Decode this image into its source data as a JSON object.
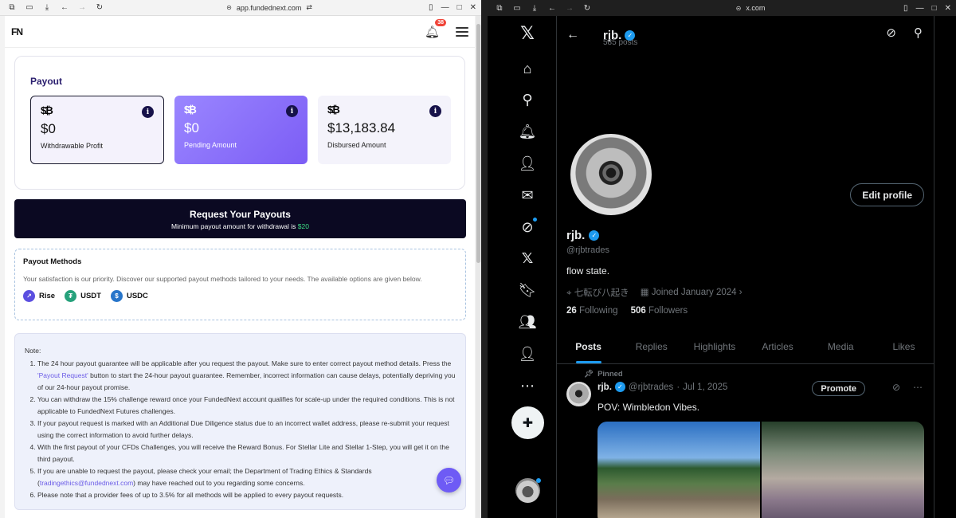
{
  "left_browser": {
    "url": "app.fundednext.com"
  },
  "fundednext": {
    "logo": "FN",
    "notification_count": "38",
    "payout": {
      "title": "Payout",
      "cards": [
        {
          "amount": "$0",
          "label": "Withdrawable Profit"
        },
        {
          "amount": "$0",
          "label": "Pending Amount"
        },
        {
          "amount": "$13,183.84",
          "label": "Disbursed Amount"
        }
      ]
    },
    "request": {
      "title": "Request Your Payouts",
      "subtitle_prefix": "Minimum payout amount for withdrawal is ",
      "min_amount": "$20"
    },
    "methods": {
      "title": "Payout Methods",
      "description": "Your satisfaction is our priority. Discover our supported payout methods tailored to your needs. The available options are given below.",
      "items": [
        {
          "name": "Rise",
          "color": "#5b4fe0"
        },
        {
          "name": "USDT",
          "color": "#26a17b"
        },
        {
          "name": "USDC",
          "color": "#2775ca"
        }
      ]
    },
    "note": {
      "title": "Note:",
      "item1_a": "The 24 hour payout guarantee will be applicable after you request the payout. Make sure to enter correct payout method details. Press the ",
      "item1_link": "'Payout Request'",
      "item1_b": " button to start the 24-hour payout guarantee. Remember, incorrect information can cause delays, potentially depriving you of our 24-hour payout promise.",
      "item2": "You can withdraw the 15% challenge reward once your FundedNext account qualifies for scale-up under the required conditions. This is not applicable to FundedNext Futures challenges.",
      "item3": "If your payout request is marked with an Additional Due Diligence status due to an incorrect wallet address, please re-submit your request using the correct information to avoid further delays.",
      "item4": "With the first payout of your CFDs Challenges, you will receive the Reward Bonus. For Stellar Lite and Stellar 1-Step, you will get it on the third payout.",
      "item5_a": "If you are unable to request the payout, please check your email; the Department of Trading Ethics & Standards (",
      "item5_link": "tradingethics@fundednext.com",
      "item5_b": ") may have reached out to you regarding some concerns.",
      "item6": "Please note that a provider fees of up to 3.5% for all methods will be applied to every payout requests."
    }
  },
  "right_browser": {
    "url": "x.com"
  },
  "x": {
    "header": {
      "name": "rjb.",
      "posts": "585 posts"
    },
    "profile": {
      "edit_label": "Edit profile",
      "name": "rjb.",
      "handle": "@rjbtrades",
      "bio": "flow state.",
      "location": "七転び八起き",
      "joined": "Joined January 2024",
      "following_count": "26",
      "following_label": "Following",
      "followers_count": "506",
      "followers_label": "Followers"
    },
    "tabs": [
      "Posts",
      "Replies",
      "Highlights",
      "Articles",
      "Media",
      "Likes"
    ],
    "post": {
      "pinned_label": "Pinned",
      "name": "rjb.",
      "handle": "@rjbtrades",
      "date": "Jul 1, 2025",
      "promote_label": "Promote",
      "text": "POV: Wimbledon Vibes."
    }
  }
}
